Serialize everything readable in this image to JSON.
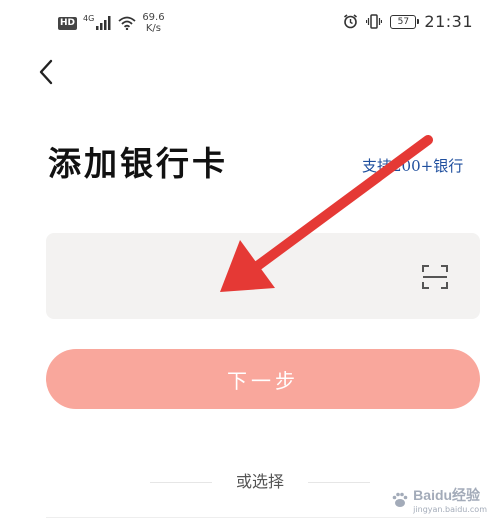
{
  "status_bar": {
    "hd_badge": "HD",
    "network_type": "4G",
    "speed_value": "69.6",
    "speed_unit": "K/s",
    "battery_level": "57",
    "time": "21:31"
  },
  "header": {
    "back_icon": "chevron-left-icon"
  },
  "page": {
    "title": "添加银行卡",
    "support_text": "支持200+银行"
  },
  "card_input": {
    "value": "",
    "placeholder": "",
    "scan_icon": "scan-frame-icon"
  },
  "actions": {
    "next_label": "下一步"
  },
  "alternative": {
    "label": "或选择"
  },
  "watermark": {
    "text": "Baidu经验",
    "sub": "jingyan.baidu.com"
  },
  "colors": {
    "next_button": "#f9a79c",
    "annotation_arrow": "#e53935",
    "support_link": "#1f4f9e",
    "field_background": "#f3f2f1"
  }
}
